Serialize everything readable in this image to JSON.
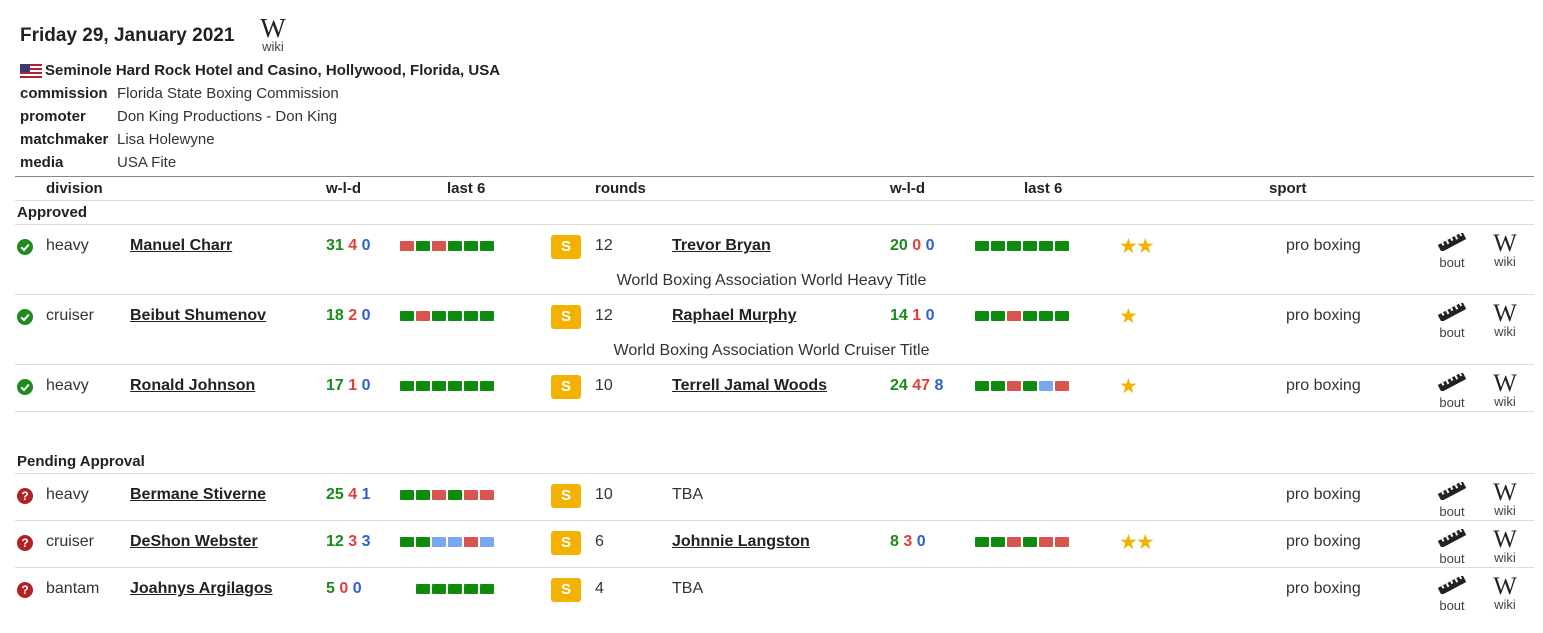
{
  "event": {
    "date": "Friday 29, January 2021",
    "wiki_label": "wiki",
    "venue": "Seminole Hard Rock Hotel and Casino, Hollywood, Florida, USA",
    "commission_label": "commission",
    "commission": "Florida State Boxing Commission",
    "promoter_label": "promoter",
    "promoter": "Don King Productions - Don King",
    "matchmaker_label": "matchmaker",
    "matchmaker": "Lisa Holewyne",
    "media_label": "media",
    "media": "USA Fite"
  },
  "headers": {
    "division": "division",
    "wld1": "w-l-d",
    "last6_1": "last 6",
    "rounds": "rounds",
    "wld2": "w-l-d",
    "last6_2": "last 6",
    "sport": "sport"
  },
  "sections": {
    "approved": "Approved",
    "pending": "Pending Approval"
  },
  "colors": {
    "win": "#1a8a1a",
    "loss": "#e0403c",
    "draw": "#2f5fd6",
    "badge": "#f3b200",
    "approved_icon": "#1f8a1f",
    "pending_icon": "#b22222"
  },
  "bouts": [
    {
      "status": "approved",
      "division": "heavy",
      "fighter1": "Manuel Charr",
      "f1_w": "31",
      "f1_l": "4",
      "f1_d": "0",
      "f1_last6": [
        "r",
        "g",
        "r",
        "g",
        "g",
        "g"
      ],
      "badge": "S",
      "rounds": "12",
      "fighter2": "Trevor Bryan",
      "f2_w": "20",
      "f2_l": "0",
      "f2_d": "0",
      "f2_last6": [
        "g",
        "g",
        "g",
        "g",
        "g",
        "g"
      ],
      "stars": 2,
      "sport": "pro boxing",
      "bout_label": "bout",
      "wiki_label": "wiki",
      "title": "World Boxing Association World Heavy Title"
    },
    {
      "status": "approved",
      "division": "cruiser",
      "fighter1": "Beibut Shumenov",
      "f1_w": "18",
      "f1_l": "2",
      "f1_d": "0",
      "f1_last6": [
        "g",
        "r",
        "g",
        "g",
        "g",
        "g"
      ],
      "badge": "S",
      "rounds": "12",
      "fighter2": "Raphael Murphy",
      "f2_w": "14",
      "f2_l": "1",
      "f2_d": "0",
      "f2_last6": [
        "g",
        "g",
        "r",
        "g",
        "g",
        "g"
      ],
      "stars": 1,
      "sport": "pro boxing",
      "bout_label": "bout",
      "wiki_label": "wiki",
      "title": "World Boxing Association World Cruiser Title"
    },
    {
      "status": "approved",
      "division": "heavy",
      "fighter1": "Ronald Johnson",
      "f1_w": "17",
      "f1_l": "1",
      "f1_d": "0",
      "f1_last6": [
        "g",
        "g",
        "g",
        "g",
        "g",
        "g"
      ],
      "badge": "S",
      "rounds": "10",
      "fighter2": "Terrell Jamal Woods",
      "f2_w": "24",
      "f2_l": "47",
      "f2_d": "8",
      "f2_last6": [
        "g",
        "g",
        "r",
        "g",
        "b",
        "r"
      ],
      "stars": 1,
      "sport": "pro boxing",
      "bout_label": "bout",
      "wiki_label": "wiki"
    },
    {
      "status": "pending",
      "division": "heavy",
      "fighter1": "Bermane Stiverne",
      "f1_w": "25",
      "f1_l": "4",
      "f1_d": "1",
      "f1_last6": [
        "g",
        "g",
        "r",
        "g",
        "r",
        "r"
      ],
      "badge": "S",
      "rounds": "10",
      "tba": "TBA",
      "sport": "pro boxing",
      "bout_label": "bout",
      "wiki_label": "wiki"
    },
    {
      "status": "pending",
      "division": "cruiser",
      "fighter1": "DeShon Webster",
      "f1_w": "12",
      "f1_l": "3",
      "f1_d": "3",
      "f1_last6": [
        "g",
        "g",
        "b",
        "b",
        "r",
        "b"
      ],
      "badge": "S",
      "rounds": "6",
      "fighter2": "Johnnie Langston",
      "f2_w": "8",
      "f2_l": "3",
      "f2_d": "0",
      "f2_last6": [
        "g",
        "g",
        "r",
        "g",
        "r",
        "r"
      ],
      "stars": 2,
      "sport": "pro boxing",
      "bout_label": "bout",
      "wiki_label": "wiki"
    },
    {
      "status": "pending",
      "division": "bantam",
      "fighter1": "Joahnys Argilagos",
      "f1_w": "5",
      "f1_l": "0",
      "f1_d": "0",
      "f1_last6": [
        "g",
        "g",
        "g",
        "g",
        "g"
      ],
      "badge": "S",
      "rounds": "4",
      "tba": "TBA",
      "sport": "pro boxing",
      "bout_label": "bout",
      "wiki_label": "wiki"
    }
  ]
}
